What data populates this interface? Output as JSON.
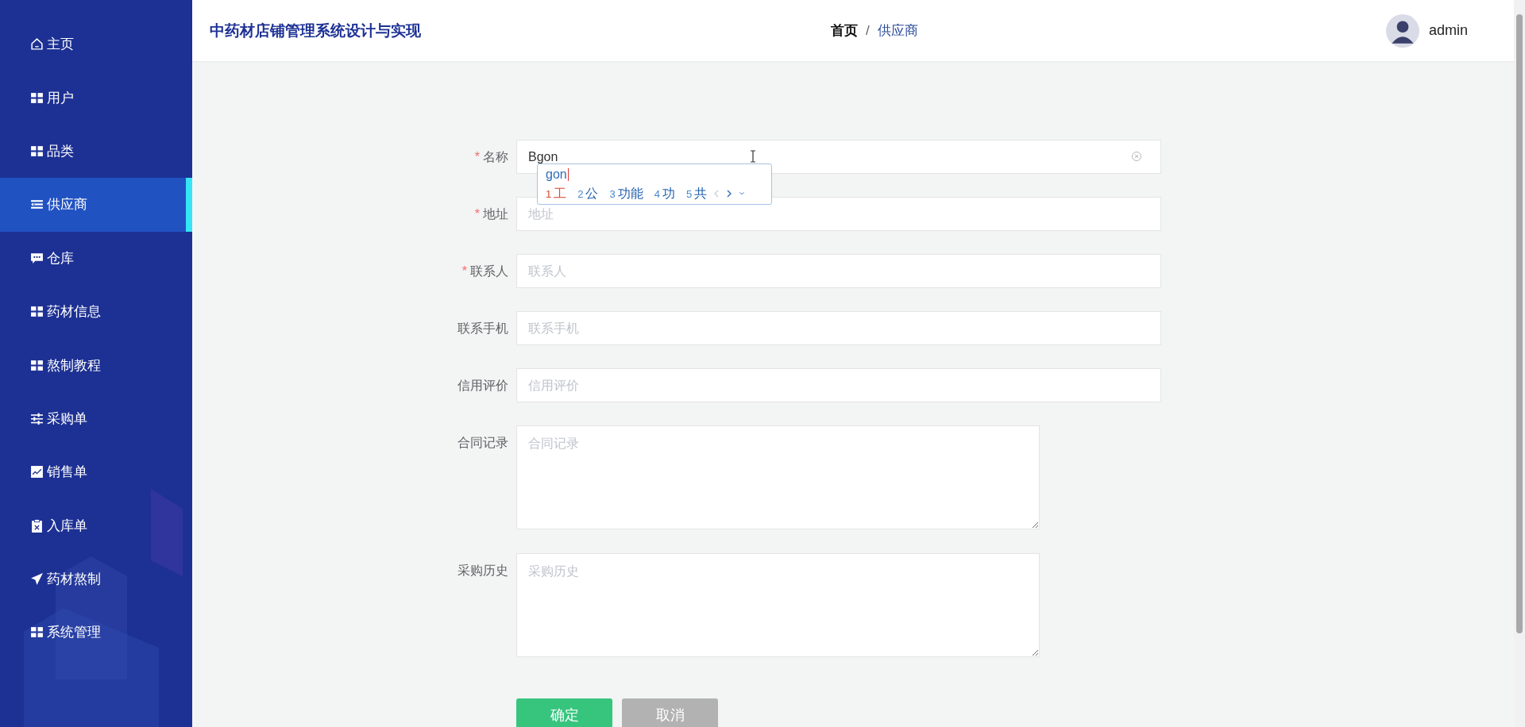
{
  "sidebar": {
    "items": [
      {
        "label": "主页",
        "kind": "home",
        "selected": false
      },
      {
        "label": "用户",
        "kind": "grid",
        "selected": false
      },
      {
        "label": "品类",
        "kind": "grid",
        "selected": false
      },
      {
        "label": "供应商",
        "kind": "list",
        "selected": true
      },
      {
        "label": "仓库",
        "kind": "chat",
        "selected": false
      },
      {
        "label": "药材信息",
        "kind": "grid",
        "selected": false
      },
      {
        "label": "熬制教程",
        "kind": "grid",
        "selected": false
      },
      {
        "label": "采购单",
        "kind": "sliders",
        "selected": false
      },
      {
        "label": "销售单",
        "kind": "chart",
        "selected": false
      },
      {
        "label": "入库单",
        "kind": "clipboard",
        "selected": false
      },
      {
        "label": "药材熬制",
        "kind": "plane",
        "selected": false
      },
      {
        "label": "系统管理",
        "kind": "grid",
        "selected": false
      }
    ]
  },
  "header": {
    "title": "中药材店铺管理系统设计与实现",
    "breadcrumb": [
      {
        "text": "首页",
        "current": false
      },
      {
        "separator": "/",
        "text": "供应商",
        "current": true
      }
    ],
    "user": {
      "name": "admin"
    }
  },
  "form": {
    "fields": [
      {
        "kind": "input",
        "label": "名称",
        "required_mark": "*",
        "value": "Bgon"
      },
      {
        "kind": "input",
        "label": "地址",
        "required_mark": "*",
        "placeholder": "地址"
      },
      {
        "kind": "input",
        "label": "联系人",
        "required_mark": "*",
        "placeholder": "联系人"
      },
      {
        "kind": "input",
        "label": "联系手机",
        "placeholder": "联系手机"
      },
      {
        "kind": "input",
        "label": "信用评价",
        "placeholder": "信用评价"
      },
      {
        "kind": "textarea",
        "label": "合同记录",
        "placeholder": "合同记录"
      },
      {
        "kind": "textarea",
        "label": "采购历史",
        "placeholder": "采购历史"
      }
    ],
    "buttons": [
      {
        "kind": "primary",
        "label": "确定"
      },
      {
        "kind": "secondary",
        "label": "取消"
      }
    ]
  },
  "ime": {
    "composition": "gon",
    "candidates": [
      {
        "index": "1",
        "text": "工",
        "selected": true
      },
      {
        "index": "2",
        "text": "公",
        "selected": false
      },
      {
        "index": "3",
        "text": "功能",
        "selected": false
      },
      {
        "index": "4",
        "text": "功",
        "selected": false
      },
      {
        "index": "5",
        "text": "共",
        "selected": false
      }
    ]
  }
}
